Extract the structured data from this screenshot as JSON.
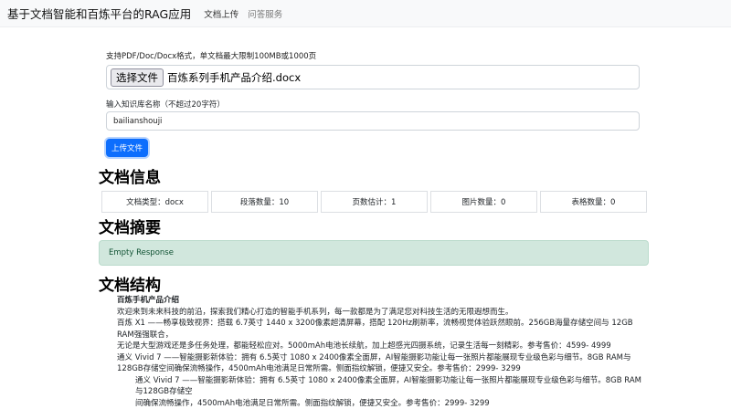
{
  "navbar": {
    "brand": "基于文档智能和百炼平台的RAG应用",
    "links": [
      "文档上传",
      "问答服务"
    ]
  },
  "upload": {
    "hint": "支持PDF/Doc/Docx格式，单文档最大限制100MB或1000页",
    "file_button": "选择文件",
    "file_name": "百炼系列手机产品介绍.docx",
    "kb_label": "输入知识库名称（不超过20字符）",
    "kb_value": "bailianshouji",
    "submit_label": "上传文件"
  },
  "doc_info": {
    "title": "文档信息",
    "stats": [
      "文档类型：docx",
      "段落数量：10",
      "页数估计：1",
      "图片数量：0",
      "表格数量：0"
    ]
  },
  "summary": {
    "title": "文档摘要",
    "text": "Empty Response"
  },
  "structure": {
    "title": "文档结构",
    "heading": "百炼手机产品介绍",
    "lines": [
      "欢迎来到未来科技的前沿，探索我们精心打造的智能手机系列，每一款都是为了满足您对科技生活的无限遐想而生。",
      "百炼 X1 ——畅享极致视界：搭载 6.7英寸 1440 x 3200像素超清屏幕，搭配 120Hz刷新率，流畅视觉体验跃然眼前。256GB海量存储空间与 12GB RAM强强联合，",
      "无论是大型游戏还是多任务处理，都能轻松应对。5000mAh电池长续航，加上超感光四摄系统，记录生活每一刻精彩。参考售价：4599- 4999",
      "通义 Vivid 7 ——智能摄影新体验：拥有 6.5英寸 1080 x 2400像素全面屏，AI智能摄影功能让每一张照片都能展现专业级色彩与细节。8GB RAM与128GB存储空间确保流畅操作，4500mAh电池满足日常所需。侧面指纹解锁，便捷又安全。参考售价：2999- 3299",
      "通义 Vivid 7 ——智能摄影新体验：拥有 6.5英寸 1080 x 2400像素全面屏，AI智能摄影功能让每一张照片都能展现专业级色彩与细节。8GB RAM与128GB存储空",
      "间确保流畅操作，4500mAh电池满足日常所需。侧面指纹解锁，便捷又安全。参考售价：2999- 3299"
    ]
  }
}
